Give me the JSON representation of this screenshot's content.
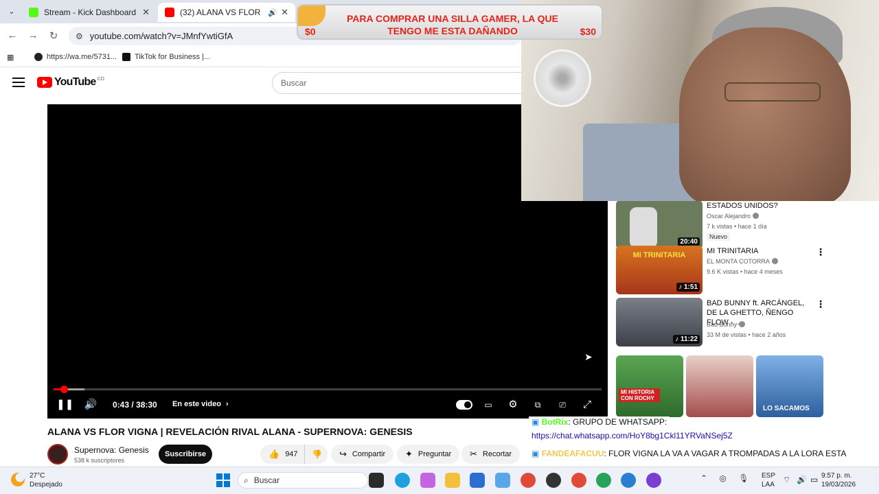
{
  "browser": {
    "tabs": [
      {
        "title": "Stream - Kick Dashboard",
        "active": false,
        "favicon_color": "#53fc18"
      },
      {
        "title": "(32) ALANA VS FLOR VIGNA",
        "active": true,
        "favicon_color": "#ff0000"
      }
    ],
    "url": "youtube.com/watch?v=JMnfYwtiGfA",
    "bookmarks": [
      "https://wa.me/5731...",
      "TikTok for Business |..."
    ]
  },
  "youtube": {
    "logo_text": "YouTube",
    "country_code": "CO",
    "search_placeholder": "Buscar"
  },
  "player": {
    "current_time_display": "0:43 / 38:30",
    "progress_fraction": 0.0186,
    "chapter_label": "En este video",
    "chapter_chevron": "›"
  },
  "video": {
    "title": "ALANA VS FLOR VIGNA | REVELACIÓN RIVAL ALANA - SUPERNOVA: GENESIS",
    "channel": "Supernova: Genesis",
    "subscribers": "538 k suscriptores",
    "subscribe_label": "Suscribirse",
    "likes": "947",
    "share_label": "Compartir",
    "ask_label": "Preguntar",
    "clip_label": "Recortar"
  },
  "donation": {
    "message": "PARA COMPRAR UNA SILLA GAMER, LA QUE TENGO ME ESTA DAÑANDO",
    "min_label": "$0",
    "max_label": "$30"
  },
  "recommendations": [
    {
      "title": "ESTADOS UNIDOS?",
      "channel": "Oscar Alejandro",
      "meta": "7 k vistas • hace 1 día",
      "badge": "Nuevo",
      "duration": "20:40",
      "thumb_color": "#6b7c5c",
      "thumb_text": ""
    },
    {
      "title": "MI TRINITARIA",
      "channel": "EL MONTA COTORRA",
      "meta": "9.6 K vistas • hace 4 meses",
      "duration": "1:51",
      "thumb_color": "#d8731f",
      "thumb_text": "MI TRINITARIA"
    },
    {
      "title": "BAD BUNNY ft. ARCÁNGEL, DE LA GHETTO, ÑENGO FLOW - ...",
      "channel": "Bad Bunny",
      "meta": "33 M de vistas • hace 2 años",
      "duration": "11:22",
      "thumb_color": "#5a5e66",
      "thumb_text": ""
    }
  ],
  "shorts": [
    {
      "caption": "MI HISTORIA CON ROCHY",
      "color": "#3f8a3c"
    },
    {
      "caption": "",
      "color": "#c65a5a"
    },
    {
      "caption": "LO SACAMOS",
      "color": "#3f7fc8"
    }
  ],
  "chat": [
    {
      "user": "BotRix",
      "text": ": GRUPO DE WHATSAPP:",
      "user_color": "#53fc18"
    },
    {
      "user": "",
      "text": "https://chat.whatsapp.com/HoY8bg1Ckl11YRVaNSej5Z",
      "user_color": "#1a0dab"
    },
    {
      "user": "FANDEAFACUU",
      "text": ": FLOR VIGNA LA VA A VAGAR A TROMPADAS A LA LORA ESTA",
      "user_color": "#f2c94c"
    }
  ],
  "taskbar": {
    "weather_temp": "27°C",
    "weather_desc": "Despejado",
    "search_label": "Buscar",
    "lang1": "ESP",
    "lang2": "LAA",
    "time": "9:57 p. m.",
    "date": "19/03/2026"
  },
  "icons": [
    "search-icon",
    "home-icon",
    "pause-icon",
    "volume-icon",
    "settings-icon",
    "fullscreen-icon",
    "like-icon",
    "dislike-icon",
    "share-icon",
    "scissors-icon"
  ]
}
